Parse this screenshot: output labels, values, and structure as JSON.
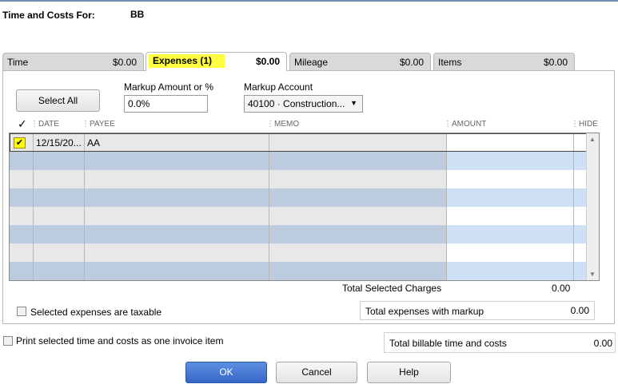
{
  "header": {
    "label": "Time and Costs For:",
    "value": "BB"
  },
  "tabs": [
    {
      "label": "Time",
      "amount": "$0.00"
    },
    {
      "label": "Expenses (1)",
      "amount": "$0.00"
    },
    {
      "label": "Mileage",
      "amount": "$0.00"
    },
    {
      "label": "Items",
      "amount": "$0.00"
    }
  ],
  "controls": {
    "select_all": "Select All",
    "markup_label": "Markup Amount or %",
    "markup_value": "0.0%",
    "markup_account_label": "Markup Account",
    "markup_account_value": "40100 · Construction..."
  },
  "table": {
    "check_header": "✓",
    "columns": [
      "DATE",
      "PAYEE",
      "MEMO",
      "AMOUNT",
      "HIDE"
    ],
    "rows": [
      {
        "checked": true,
        "date": "12/15/20...",
        "payee": "AA",
        "memo": "",
        "amount": "",
        "hide": ""
      }
    ],
    "total_label": "Total Selected Charges",
    "total_value": "0.00"
  },
  "taxable_label": "Selected expenses are taxable",
  "markup_total": {
    "label": "Total expenses with markup",
    "value": "0.00"
  },
  "print_label": "Print selected time and costs as one invoice item",
  "billable_total": {
    "label": "Total billable time and costs",
    "value": "0.00"
  },
  "buttons": {
    "ok": "OK",
    "cancel": "Cancel",
    "help": "Help"
  },
  "colors": {
    "highlight": "#ffff40",
    "row_alt": "#cfe0f4",
    "primary_button": "#3566c9"
  }
}
